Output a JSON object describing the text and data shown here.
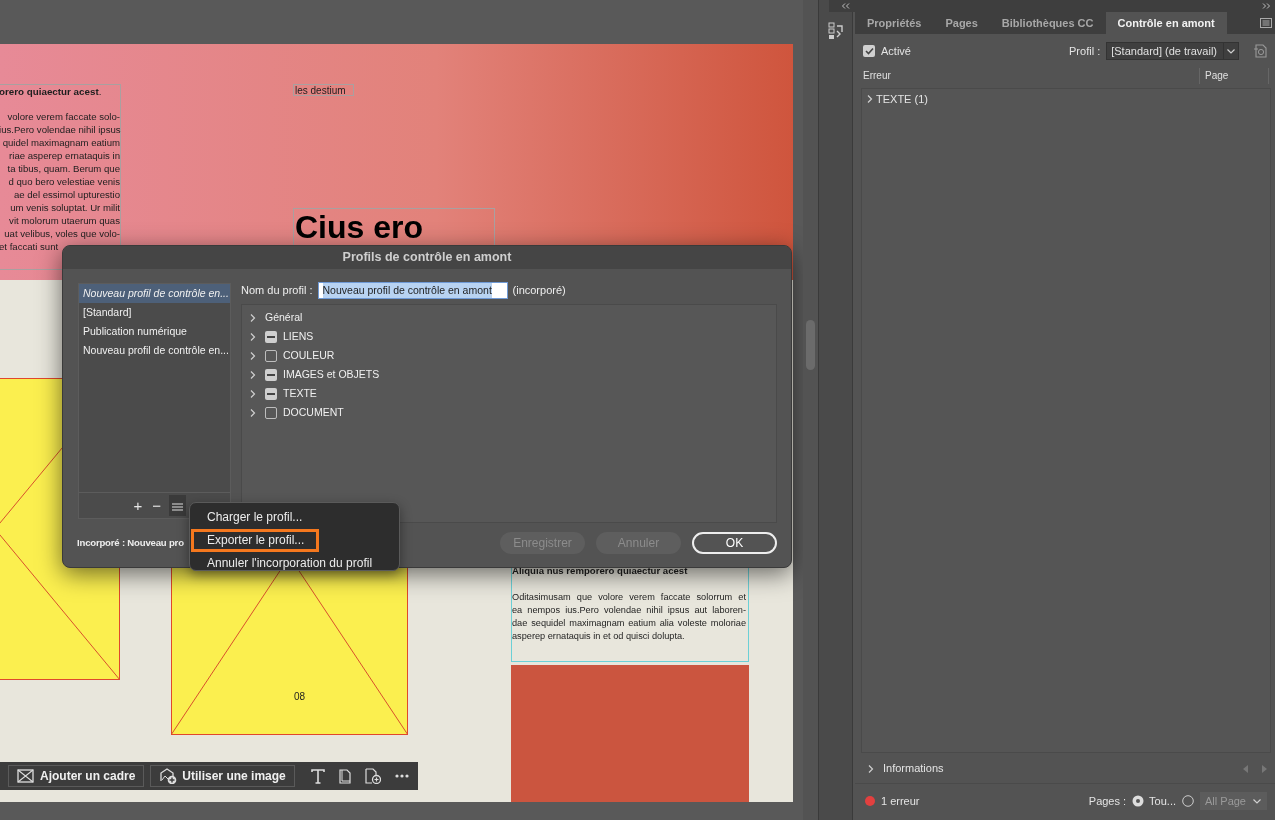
{
  "document": {
    "left_heading": "**orero quiaectur acest**.",
    "left_paragraph_lines": [
      "volore verem faccate solo-",
      "ius.Pero volendae nihil ipsus",
      "quidel maximagnam eatium",
      "riae asperep ernataquis in",
      "ta tibus, quam. Berum que",
      "d quo bero velestiae venis",
      "ae del essimol upturestio",
      "um venis soluptat. Ur milit",
      "vit molorum utaerum quas",
      "uat velibus, voles que volo-",
      "et faccati sunt"
    ],
    "caption": "les destium",
    "title": "Cius ero",
    "page_number": "08",
    "right_heading": "Aliquia nus remporero quiaectur acest",
    "right_paragraph_lines": [
      "Oditasimusam que volore verem faccate solorrum et",
      "ea nempos ius.Pero volendae nihil ipsus aut laboren-",
      "dae sequidel maximagnam eatium alia voleste moloriae",
      "asperep ernataquis in et od quisci dolupta."
    ]
  },
  "context_toolbar": {
    "buttons": [
      {
        "label": "Ajouter un cadre"
      },
      {
        "label": "Utiliser une image"
      }
    ]
  },
  "dialog": {
    "title": "Profils de contrôle en amont",
    "profiles": [
      {
        "label": "Nouveau profil de contrôle en...",
        "selected": true
      },
      {
        "label": "[Standard]",
        "selected": false
      },
      {
        "label": "Publication numérique",
        "selected": false
      },
      {
        "label": "Nouveau profil de contrôle en...",
        "selected": false
      }
    ],
    "list_buttons": [
      "+",
      "−"
    ],
    "name_label": "Nom du profil :",
    "name_value": "Nouveau profil de contrôle en amont",
    "name_note": "(incorporé)",
    "tree": [
      {
        "kind": "heading",
        "label": "Général",
        "expanded": false
      },
      {
        "kind": "checkbox",
        "label": "LIENS",
        "expanded": false,
        "mixed": true
      },
      {
        "kind": "checkbox",
        "label": "COULEUR",
        "expanded": false,
        "mixed": false
      },
      {
        "kind": "checkbox",
        "label": "IMAGES et OBJETS",
        "expanded": false,
        "mixed": true
      },
      {
        "kind": "checkbox",
        "label": "TEXTE",
        "expanded": false,
        "mixed": true
      },
      {
        "kind": "checkbox",
        "label": "DOCUMENT",
        "expanded": false,
        "mixed": false
      }
    ],
    "footer_text": "Incorporé : Nouveau pro",
    "buttons": [
      {
        "label": "Enregistrer",
        "disabled": true,
        "default": false
      },
      {
        "label": "Annuler",
        "disabled": true,
        "default": false
      },
      {
        "label": "OK",
        "disabled": false,
        "default": true
      }
    ]
  },
  "popup_menu": {
    "items": [
      {
        "label": "Charger le profil...",
        "highlighted": false
      },
      {
        "label": "Exporter le profil...",
        "highlighted": true
      },
      {
        "label": "Annuler l'incorporation du profil",
        "highlighted": false
      }
    ]
  },
  "panel": {
    "tabs": [
      {
        "label": "Propriétés",
        "selected": false
      },
      {
        "label": "Pages",
        "selected": false
      },
      {
        "label": "Bibliothèques CC",
        "selected": false
      },
      {
        "label": "Contrôle en amont",
        "selected": true
      }
    ],
    "enabled": {
      "label": "Activé",
      "checked": true
    },
    "profile_label": "Profil :",
    "profile_value": "[Standard] (de travail)",
    "columns": [
      "Erreur",
      "Page"
    ],
    "errors": [
      {
        "label": "TEXTE (1)",
        "expanded": false
      }
    ],
    "info_label": "Informations",
    "status_text": "1 erreur",
    "pages_label": "Pages :",
    "page_options": [
      {
        "label": "Tou...",
        "selected": true
      },
      {
        "selected": false
      }
    ],
    "page_range": "All Page"
  }
}
